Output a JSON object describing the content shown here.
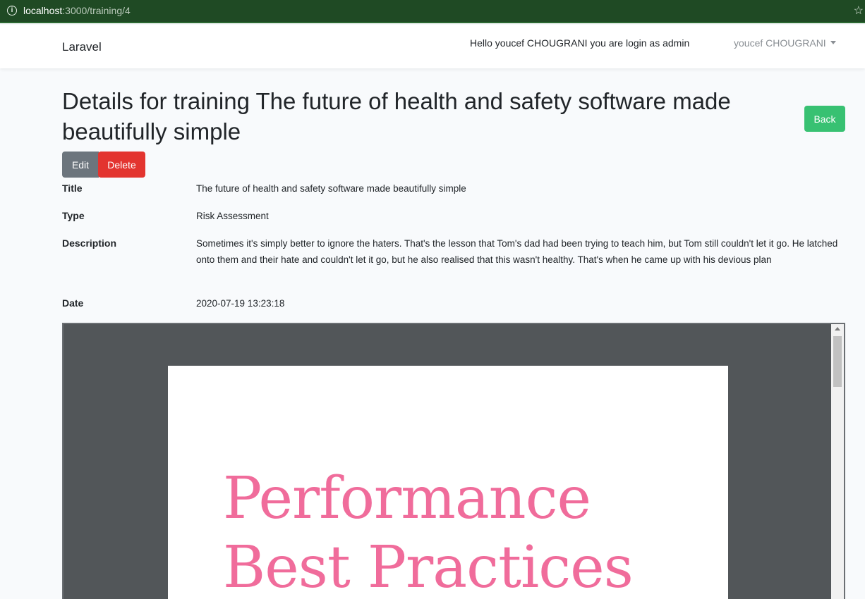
{
  "browser": {
    "url_host": "localhost",
    "url_path": ":3000/training/4",
    "info_icon": "info-icon",
    "bookmark_icon": "star-icon"
  },
  "navbar": {
    "brand": "Laravel",
    "greeting": "Hello youcef CHOUGRANI you are login as admin",
    "user": "youcef CHOUGRANI"
  },
  "page": {
    "title": "Details for training The future of health and safety software made beautifully simple",
    "back_label": "Back",
    "edit_label": "Edit",
    "delete_label": "Delete"
  },
  "details": {
    "title_label": "Title",
    "title_value": "The future of health and safety software made beautifully simple",
    "type_label": "Type",
    "type_value": "Risk Assessment",
    "description_label": "Description",
    "description_value": "Sometimes it's simply better to ignore the haters. That's the lesson that Tom's dad had been trying to teach him, but Tom still couldn't let it go. He latched onto them and their hate and couldn't let it go, but he also realised that this wasn't healthy. That's when he came up with his devious plan",
    "date_label": "Date",
    "date_value": "2020-07-19 13:23:18"
  },
  "pdf": {
    "heading": "Performance\nBest Practices"
  },
  "colors": {
    "success": "#38c172",
    "danger": "#e3342f",
    "secondary": "#6c757d",
    "pdf_heading": "#f06c9b",
    "viewer_bg": "#525659"
  }
}
